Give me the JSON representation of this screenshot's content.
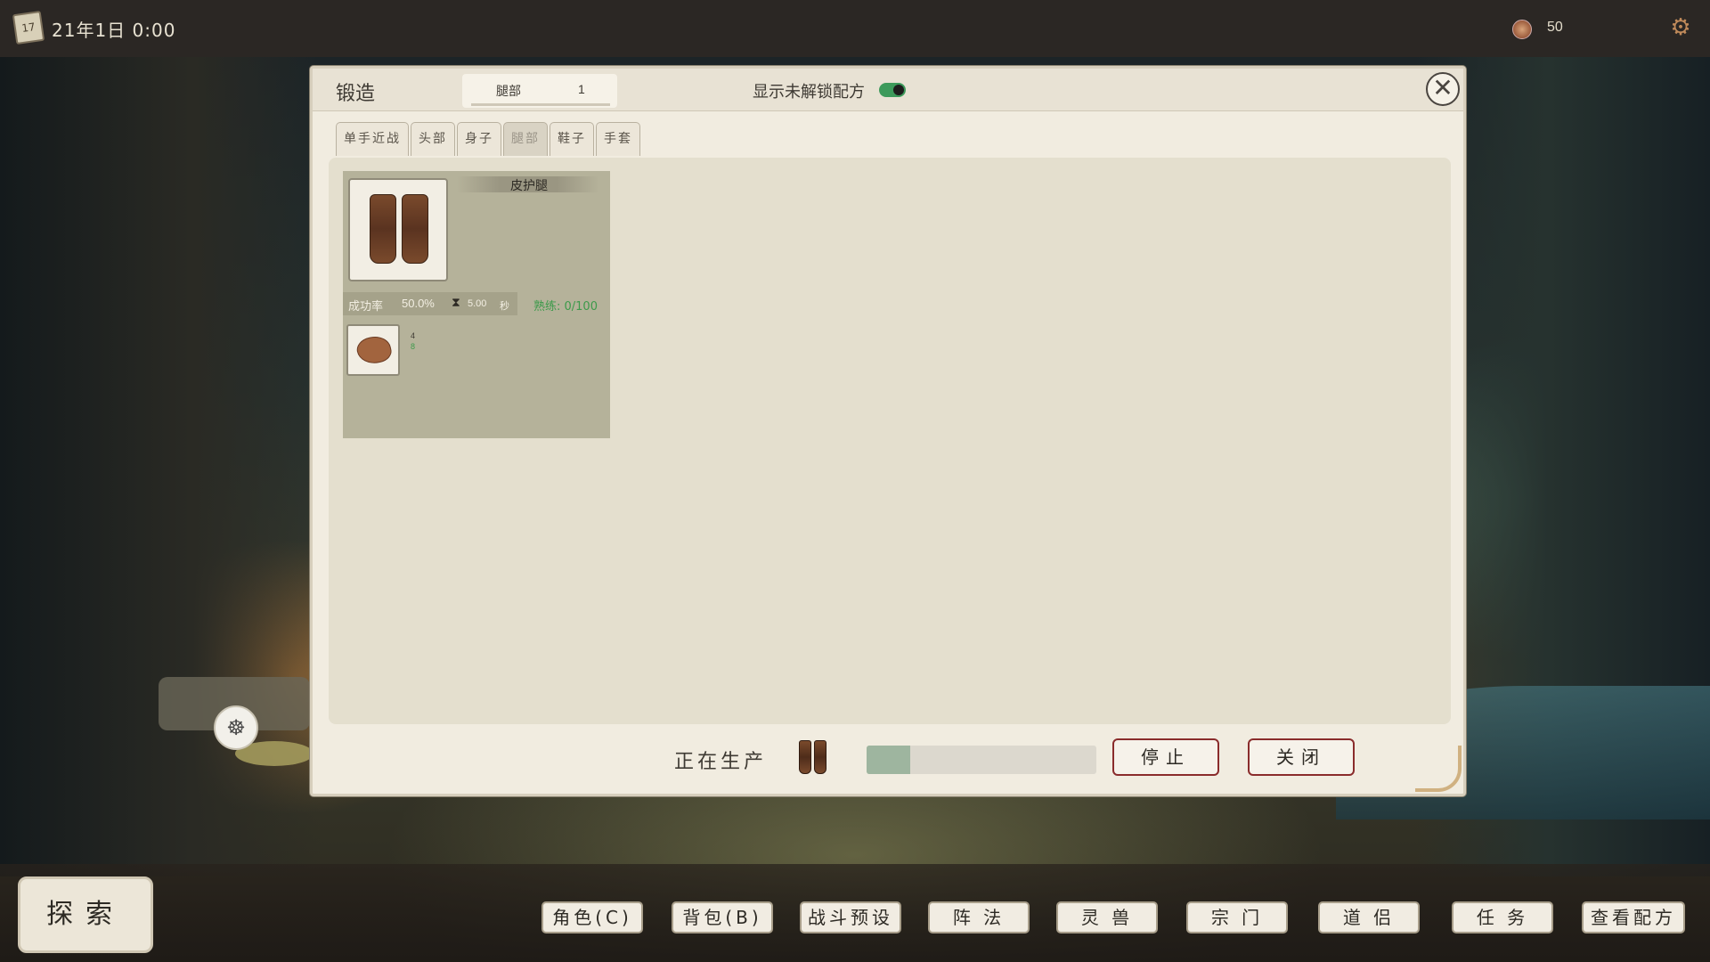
{
  "top_bar": {
    "calendar_icon_text": "17",
    "date_time": "21年1日  0:00",
    "currency_value": "50"
  },
  "dialog": {
    "title": "锻造",
    "filter": {
      "label": "腿部",
      "count": "1"
    },
    "show_locked_label": "显示未解锁配方",
    "show_locked_on": true,
    "tabs": [
      {
        "label": "单手近战",
        "active": false
      },
      {
        "label": "头部",
        "active": false
      },
      {
        "label": "身子",
        "active": false
      },
      {
        "label": "腿部",
        "active": true
      },
      {
        "label": "鞋子",
        "active": false
      },
      {
        "label": "手套",
        "active": false
      }
    ],
    "recipe": {
      "name": "皮护腿",
      "success_label": "成功率",
      "success_rate": "50.0%",
      "time_value": "5.00",
      "time_unit": "秒",
      "mastery": "熟练: 0/100",
      "material_required": "4",
      "material_owned": "8"
    },
    "producing_label": "正在生产",
    "progress": 0.19,
    "stop_label": "停止",
    "close_label": "关闭"
  },
  "bottom_bar": {
    "explore_label": "探索",
    "buttons": [
      "角色(C)",
      "背包(B)",
      "战斗预设",
      "阵 法",
      "灵 兽",
      "宗 门",
      "道 侣",
      "任 务",
      "查看配方"
    ]
  },
  "colors": {
    "accent_green": "#3d9a5b",
    "button_border_red": "#8a2c2c",
    "progress_fill": "#9eb59f"
  }
}
